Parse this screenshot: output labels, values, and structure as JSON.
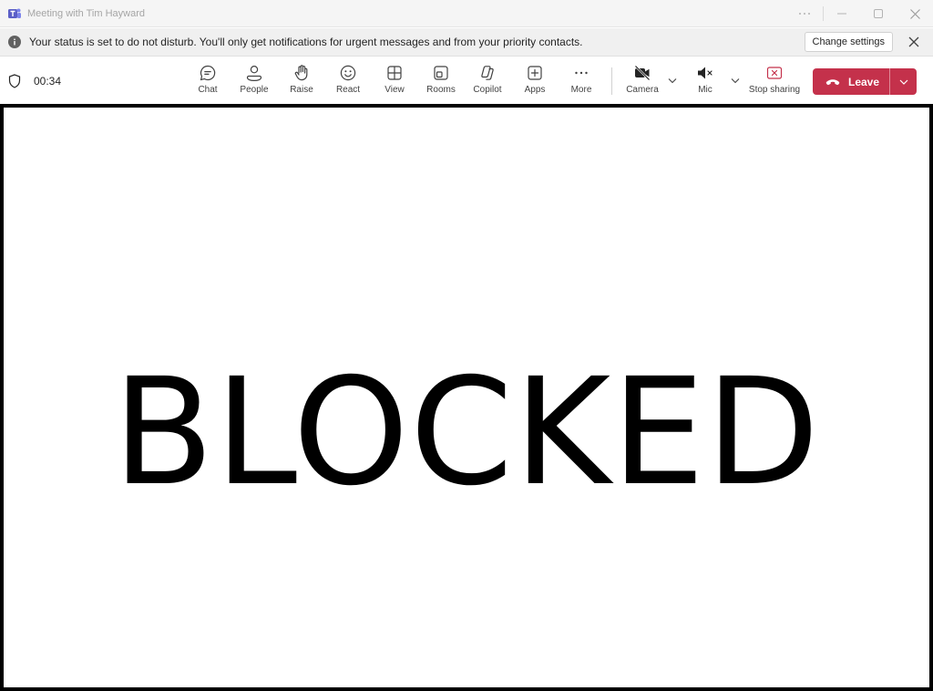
{
  "window": {
    "title": "Meeting with Tim Hayward",
    "app_icon": "teams-icon",
    "controls": [
      "more-icon",
      "minimize-icon",
      "maximize-icon",
      "close-icon"
    ]
  },
  "notification": {
    "icon": "info-icon",
    "text": "Your status is set to do not disturb. You'll only get notifications for urgent messages and from your priority contacts.",
    "action_label": "Change settings",
    "dismiss_icon": "close-icon"
  },
  "toolbar": {
    "security_icon": "shield-icon",
    "timer": "00:34",
    "items": [
      {
        "label": "Chat",
        "icon": "chat-icon"
      },
      {
        "label": "People",
        "icon": "people-icon"
      },
      {
        "label": "Raise",
        "icon": "hand-icon"
      },
      {
        "label": "React",
        "icon": "smile-icon"
      },
      {
        "label": "View",
        "icon": "grid-icon"
      },
      {
        "label": "Rooms",
        "icon": "rooms-icon"
      },
      {
        "label": "Copilot",
        "icon": "copilot-icon"
      },
      {
        "label": "Apps",
        "icon": "plus-square-icon"
      },
      {
        "label": "More",
        "icon": "ellipsis-icon"
      }
    ],
    "camera": {
      "label": "Camera",
      "icon": "camera-off-icon"
    },
    "mic": {
      "label": "Mic",
      "icon": "mic-muted-icon"
    },
    "stop_sharing": {
      "label": "Stop sharing",
      "icon": "stop-share-icon"
    },
    "leave": {
      "label": "Leave",
      "icon": "phone-hangup-icon"
    }
  },
  "stage": {
    "text": "BLOCKED"
  },
  "colors": {
    "leave_red": "#c4314b",
    "teams_purple": "#5b5fc7",
    "stop_share_red": "#c4314b"
  }
}
